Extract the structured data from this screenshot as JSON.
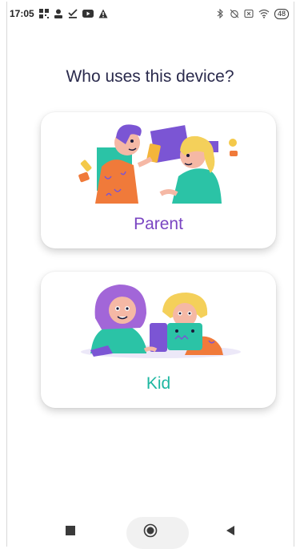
{
  "status_bar": {
    "time": "17:05",
    "battery": "48",
    "left_icons": [
      "qr-icon",
      "person-icon",
      "download-check-icon",
      "youtube-icon",
      "warning-icon"
    ],
    "right_icons": [
      "bluetooth-icon",
      "alarm-off-icon",
      "sim-icon",
      "wifi-icon",
      "battery-icon"
    ]
  },
  "screen": {
    "title": "Who uses this device?"
  },
  "options": [
    {
      "label": "Parent"
    },
    {
      "label": "Kid"
    }
  ],
  "colors": {
    "parent_label": "#7a45c2",
    "kid_label": "#1eb7a1",
    "title": "#2b2b4d"
  },
  "nav_bar": {
    "items": [
      "recents-square-icon",
      "home-circle-icon",
      "back-triangle-icon"
    ]
  }
}
